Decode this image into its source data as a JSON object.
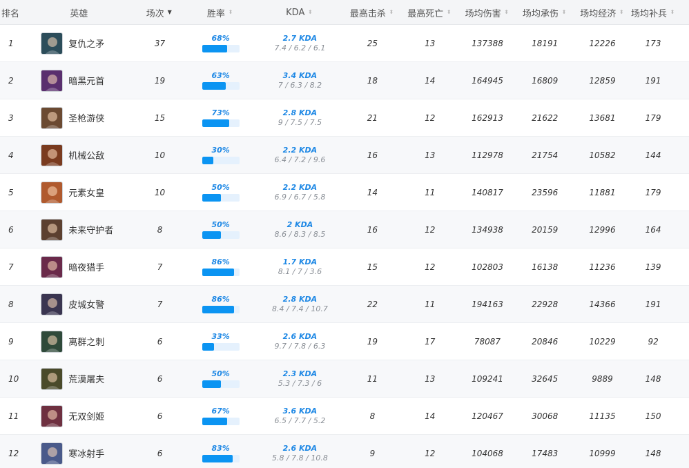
{
  "headers": {
    "rank": "排名",
    "hero": "英雄",
    "games": "场次",
    "winrate": "胜率",
    "kda": "KDA",
    "max_kills": "最高击杀",
    "max_deaths": "最高死亡",
    "avg_damage": "场均伤害",
    "avg_taken": "场均承伤",
    "avg_gold": "场均经济",
    "avg_cs": "场均补兵"
  },
  "colors": {
    "accent": "#1e88e5",
    "bar_fill": "#0b94f2",
    "bar_track": "#e5f1fd"
  },
  "rows": [
    {
      "rank": "1",
      "hero": "复仇之矛",
      "icon": "hero-portrait-icon",
      "avatar_color": "#2c4d5a",
      "games": "37",
      "winrate": "68%",
      "winrate_value": 0.68,
      "kda": "2.7 KDA",
      "kda_detail": "7.4 / 6.2 / 6.1",
      "max_kills": "25",
      "max_deaths": "13",
      "avg_damage": "137388",
      "avg_taken": "18191",
      "avg_gold": "12226",
      "avg_cs": "173"
    },
    {
      "rank": "2",
      "hero": "暗黑元首",
      "icon": "hero-portrait-icon",
      "avatar_color": "#5a2f6e",
      "games": "19",
      "winrate": "63%",
      "winrate_value": 0.63,
      "kda": "3.4 KDA",
      "kda_detail": "7 / 6.3 / 8.2",
      "max_kills": "18",
      "max_deaths": "14",
      "avg_damage": "164945",
      "avg_taken": "16809",
      "avg_gold": "12859",
      "avg_cs": "191"
    },
    {
      "rank": "3",
      "hero": "圣枪游侠",
      "icon": "hero-portrait-icon",
      "avatar_color": "#6b4a32",
      "games": "15",
      "winrate": "73%",
      "winrate_value": 0.73,
      "kda": "2.8 KDA",
      "kda_detail": "9 / 7.5 / 7.5",
      "max_kills": "21",
      "max_deaths": "12",
      "avg_damage": "162913",
      "avg_taken": "21622",
      "avg_gold": "13681",
      "avg_cs": "179"
    },
    {
      "rank": "4",
      "hero": "机械公敌",
      "icon": "hero-portrait-icon",
      "avatar_color": "#7a3b1f",
      "games": "10",
      "winrate": "30%",
      "winrate_value": 0.3,
      "kda": "2.2 KDA",
      "kda_detail": "6.4 / 7.2 / 9.6",
      "max_kills": "16",
      "max_deaths": "13",
      "avg_damage": "112978",
      "avg_taken": "21754",
      "avg_gold": "10582",
      "avg_cs": "144"
    },
    {
      "rank": "5",
      "hero": "元素女皇",
      "icon": "hero-portrait-icon",
      "avatar_color": "#b05a2e",
      "games": "10",
      "winrate": "50%",
      "winrate_value": 0.5,
      "kda": "2.2 KDA",
      "kda_detail": "6.9 / 6.7 / 5.8",
      "max_kills": "14",
      "max_deaths": "11",
      "avg_damage": "140817",
      "avg_taken": "23596",
      "avg_gold": "11881",
      "avg_cs": "179"
    },
    {
      "rank": "6",
      "hero": "未来守护者",
      "icon": "hero-portrait-icon",
      "avatar_color": "#5c4030",
      "games": "8",
      "winrate": "50%",
      "winrate_value": 0.5,
      "kda": "2 KDA",
      "kda_detail": "8.6 / 8.3 / 8.5",
      "max_kills": "16",
      "max_deaths": "12",
      "avg_damage": "134938",
      "avg_taken": "20159",
      "avg_gold": "12996",
      "avg_cs": "164"
    },
    {
      "rank": "7",
      "hero": "暗夜猎手",
      "icon": "hero-portrait-icon",
      "avatar_color": "#6a2a4a",
      "games": "7",
      "winrate": "86%",
      "winrate_value": 0.86,
      "kda": "1.7 KDA",
      "kda_detail": "8.1 / 7 / 3.6",
      "max_kills": "15",
      "max_deaths": "12",
      "avg_damage": "102803",
      "avg_taken": "16138",
      "avg_gold": "11236",
      "avg_cs": "139"
    },
    {
      "rank": "8",
      "hero": "皮城女警",
      "icon": "hero-portrait-icon",
      "avatar_color": "#3a3550",
      "games": "7",
      "winrate": "86%",
      "winrate_value": 0.86,
      "kda": "2.8 KDA",
      "kda_detail": "8.4 / 7.4 / 10.7",
      "max_kills": "22",
      "max_deaths": "11",
      "avg_damage": "194163",
      "avg_taken": "22928",
      "avg_gold": "14366",
      "avg_cs": "191"
    },
    {
      "rank": "9",
      "hero": "离群之刺",
      "icon": "hero-portrait-icon",
      "avatar_color": "#2f4a3a",
      "games": "6",
      "winrate": "33%",
      "winrate_value": 0.33,
      "kda": "2.6 KDA",
      "kda_detail": "9.7 / 7.8 / 6.3",
      "max_kills": "19",
      "max_deaths": "17",
      "avg_damage": "78087",
      "avg_taken": "20846",
      "avg_gold": "10229",
      "avg_cs": "92"
    },
    {
      "rank": "10",
      "hero": "荒漠屠夫",
      "icon": "hero-portrait-icon",
      "avatar_color": "#4a4a2a",
      "games": "6",
      "winrate": "50%",
      "winrate_value": 0.5,
      "kda": "2.3 KDA",
      "kda_detail": "5.3 / 7.3 / 6",
      "max_kills": "11",
      "max_deaths": "13",
      "avg_damage": "109241",
      "avg_taken": "32645",
      "avg_gold": "9889",
      "avg_cs": "148"
    },
    {
      "rank": "11",
      "hero": "无双剑姬",
      "icon": "hero-portrait-icon",
      "avatar_color": "#6e3040",
      "games": "6",
      "winrate": "67%",
      "winrate_value": 0.67,
      "kda": "3.6 KDA",
      "kda_detail": "6.5 / 7.7 / 5.2",
      "max_kills": "8",
      "max_deaths": "14",
      "avg_damage": "120467",
      "avg_taken": "30068",
      "avg_gold": "11135",
      "avg_cs": "150"
    },
    {
      "rank": "12",
      "hero": "寒冰射手",
      "icon": "hero-portrait-icon",
      "avatar_color": "#4a5a8a",
      "games": "6",
      "winrate": "83%",
      "winrate_value": 0.83,
      "kda": "2.6 KDA",
      "kda_detail": "5.8 / 7.8 / 10.8",
      "max_kills": "9",
      "max_deaths": "12",
      "avg_damage": "104068",
      "avg_taken": "17483",
      "avg_gold": "10999",
      "avg_cs": "148"
    }
  ]
}
